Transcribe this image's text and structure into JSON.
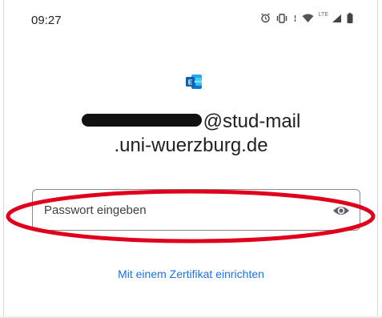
{
  "status_bar": {
    "time": "09:27",
    "network_label": "LTE",
    "icons": [
      "alarm-icon",
      "vibrate-icon",
      "wifi-icon",
      "signal-icon",
      "battery-icon"
    ]
  },
  "app": {
    "logo_icon": "exchange-logo-icon",
    "logo_letter": "E",
    "brand_color": "#0f78d4"
  },
  "account": {
    "email_line1": "@stud-mail",
    "email_line2": ".uni-wuerzburg.de"
  },
  "password": {
    "placeholder": "Passwort eingeben",
    "icon": "eye-icon"
  },
  "certificate_link": "Mit einem Zertifikat einrichten",
  "colors": {
    "link": "#1a73e8",
    "annotation": "#e0001b"
  }
}
